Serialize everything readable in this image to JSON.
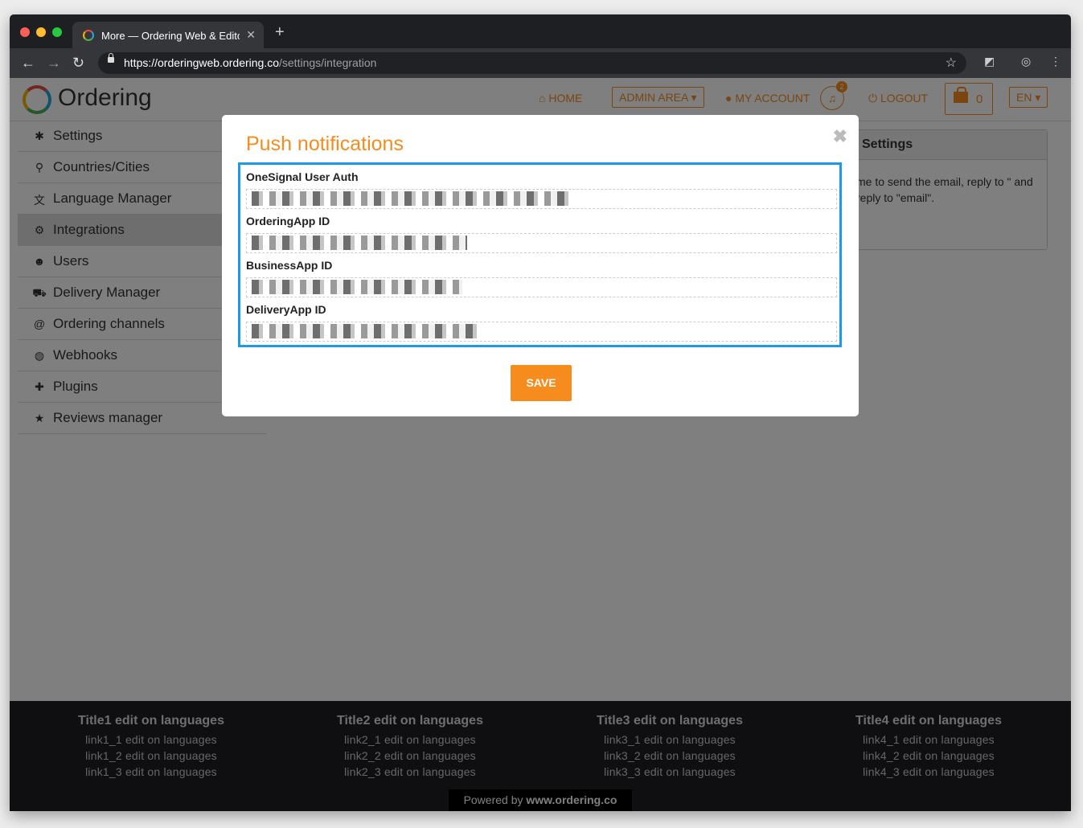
{
  "browser": {
    "tab_title": "More — Ordering Web & Editor",
    "new_tab": "+",
    "close": "✕",
    "url_main": "https://orderingweb.ordering.co",
    "url_path": "/settings/integration"
  },
  "header": {
    "logo": "Ordering",
    "home": "HOME",
    "admin_area": "ADMIN AREA",
    "my_account": "MY ACCOUNT",
    "notif_count": "2",
    "logout": "LOGOUT",
    "cart_count": "0",
    "lang": "EN"
  },
  "sidebar": {
    "items": [
      {
        "label": "Settings"
      },
      {
        "label": "Countries/Cities"
      },
      {
        "label": "Language Manager"
      },
      {
        "label": "Integrations"
      },
      {
        "label": "Users"
      },
      {
        "label": "Delivery Manager"
      },
      {
        "label": "Ordering channels"
      },
      {
        "label": "Webhooks"
      },
      {
        "label": "Plugins"
      },
      {
        "label": "Reviews manager"
      }
    ]
  },
  "panel": {
    "title": "Settings",
    "text": "me to send the email, reply to \" and reply to \"email\"."
  },
  "modal": {
    "title": "Push notifications",
    "fields": [
      {
        "label": "OneSignal User Auth"
      },
      {
        "label": "OrderingApp ID"
      },
      {
        "label": "BusinessApp ID"
      },
      {
        "label": "DeliveryApp ID"
      }
    ],
    "save": "SAVE"
  },
  "footer": {
    "columns": [
      {
        "title": "Title1 edit on languages",
        "links": [
          "link1_1 edit on languages",
          "link1_2 edit on languages",
          "link1_3 edit on languages"
        ]
      },
      {
        "title": "Title2 edit on languages",
        "links": [
          "link2_1 edit on languages",
          "link2_2 edit on languages",
          "link2_3 edit on languages"
        ]
      },
      {
        "title": "Title3 edit on languages",
        "links": [
          "link3_1 edit on languages",
          "link3_2 edit on languages",
          "link3_3 edit on languages"
        ]
      },
      {
        "title": "Title4 edit on languages",
        "links": [
          "link4_1 edit on languages",
          "link4_2 edit on languages",
          "link4_3 edit on languages"
        ]
      }
    ],
    "powered_prefix": "Powered by ",
    "powered_site": "www.ordering.co"
  }
}
